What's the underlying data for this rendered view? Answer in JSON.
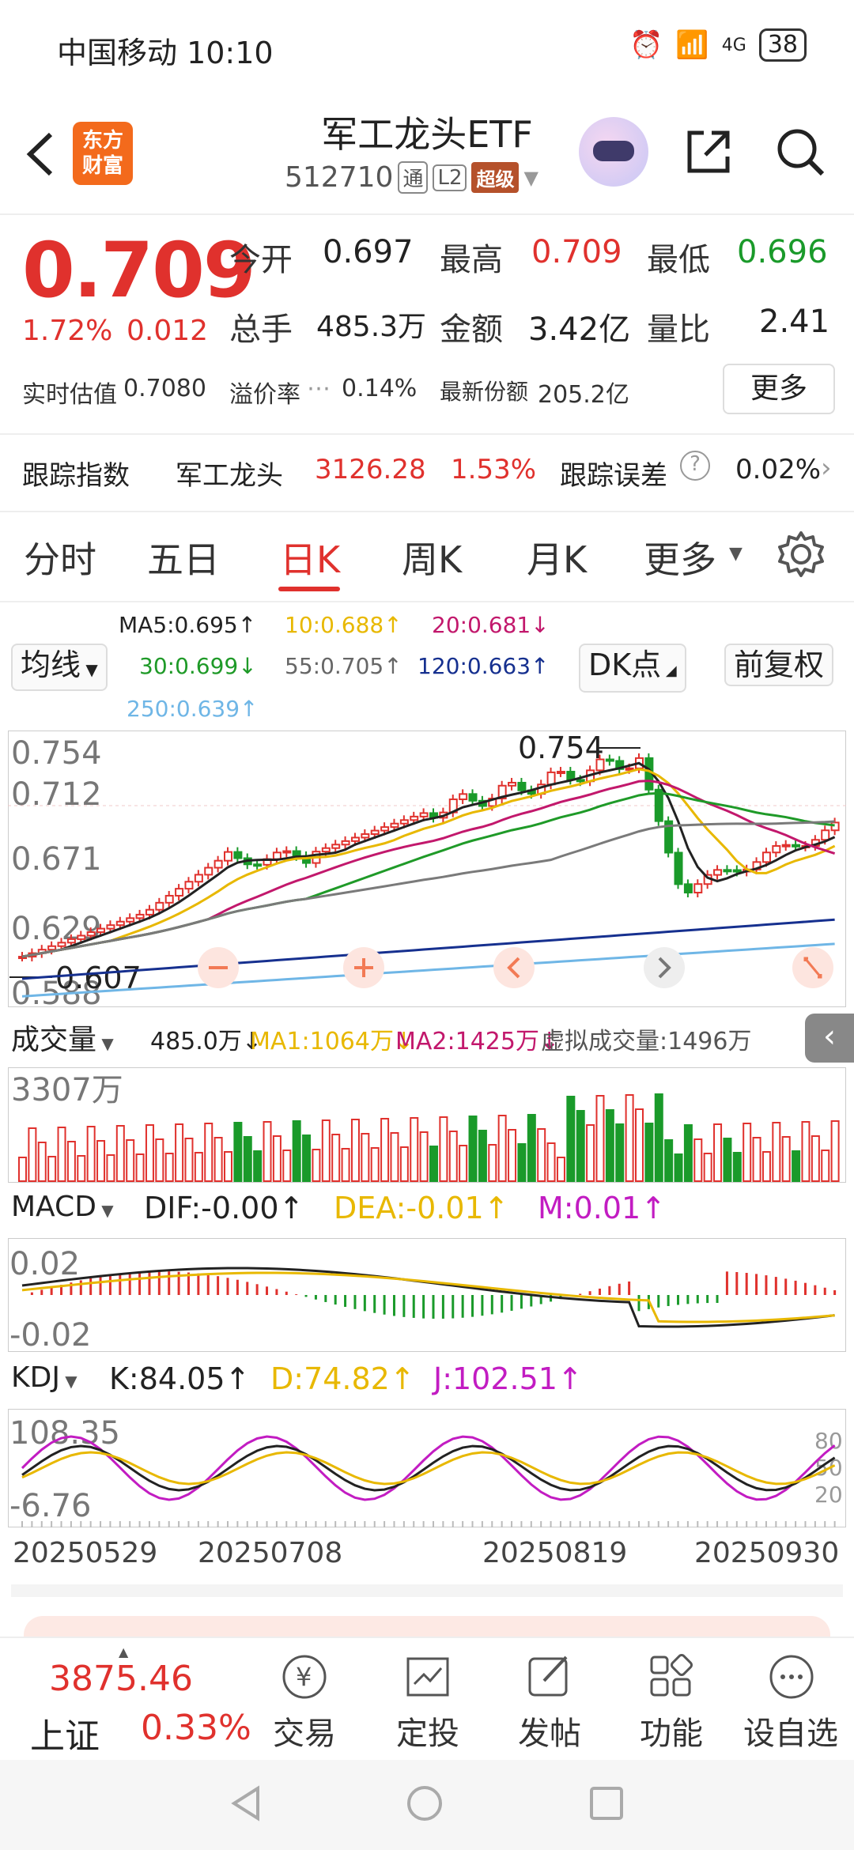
{
  "status": {
    "carrier_time": "中国移动 10:10",
    "battery": "38",
    "network": "4G"
  },
  "header": {
    "title": "军工龙头ETF",
    "code": "512710",
    "tag_tong": "通",
    "tag_l2": "L2",
    "tag_super": "超级",
    "logo": "东方\n财富"
  },
  "quote": {
    "price": "0.709",
    "change_pct": "1.72%",
    "change_val": "0.012",
    "open_label": "今开",
    "open": "0.697",
    "high_label": "最高",
    "high": "0.709",
    "low_label": "最低",
    "low": "0.696",
    "vol_label": "总手",
    "vol": "485.3万",
    "amount_label": "金额",
    "amount": "3.42亿",
    "ratio_label": "量比",
    "ratio": "2.41",
    "est_label": "实时估值",
    "est": "0.7080",
    "premium_label": "溢价率",
    "premium": "0.14%",
    "share_label": "最新份额",
    "share": "205.2亿",
    "more": "更多"
  },
  "tracking": {
    "label": "跟踪指数",
    "index_name": "军工龙头",
    "index_val": "3126.28",
    "index_pct": "1.53%",
    "error_label": "跟踪误差",
    "error": "0.02%"
  },
  "tabs": [
    "分时",
    "五日",
    "日K",
    "周K",
    "月K",
    "更多"
  ],
  "ma": {
    "ma5": "MA5:0.695↑",
    "ma10": "10:0.688↑",
    "ma20": "20:0.681↓",
    "ma30": "30:0.699↓",
    "ma55": "55:0.705↑",
    "ma120": "120:0.663↑",
    "ma250": "250:0.639↑",
    "junxian": "均线",
    "dk": "DK点",
    "fuquan": "前复权"
  },
  "kchart": {
    "y_labels": [
      "0.754",
      "0.712",
      "0.671",
      "0.629",
      "0.588"
    ],
    "max_label": "0.754",
    "min_label": "0.607"
  },
  "volume": {
    "label": "成交量",
    "v": "485.0万↓",
    "ma1": "MA1:1064万↓",
    "ma2": "MA2:1425万↓",
    "virtual": "虚拟成交量:1496万",
    "y_label": "3307万"
  },
  "macd": {
    "label": "MACD",
    "dif": "DIF:-0.00↑",
    "dea": "DEA:-0.01↑",
    "m": "M:0.01↑",
    "y_top": "0.02",
    "y_bottom": "-0.02"
  },
  "kdj": {
    "label": "KDJ",
    "k": "K:84.05↑",
    "d": "D:74.82↑",
    "j": "J:102.51↑",
    "y_top": "108.35",
    "y_bottom": "-6.76",
    "r80": "80",
    "r50": "50",
    "r20": "20"
  },
  "dates": [
    "20250529",
    "20250708",
    "20250819",
    "20250930"
  ],
  "bottom": {
    "index_val": "3875.46",
    "index_name": "上证",
    "index_pct": "0.33%",
    "items": [
      "交易",
      "定投",
      "发帖",
      "功能",
      "设自选"
    ]
  },
  "colors": {
    "up": "#e0312d",
    "down": "#1a9a2a",
    "ma5": "#222222",
    "ma10": "#e8b800",
    "ma20": "#c2186c",
    "ma30": "#1f9a28",
    "ma55": "#7a7a7a",
    "ma120": "#16308f",
    "ma250": "#6fb6e6"
  }
}
